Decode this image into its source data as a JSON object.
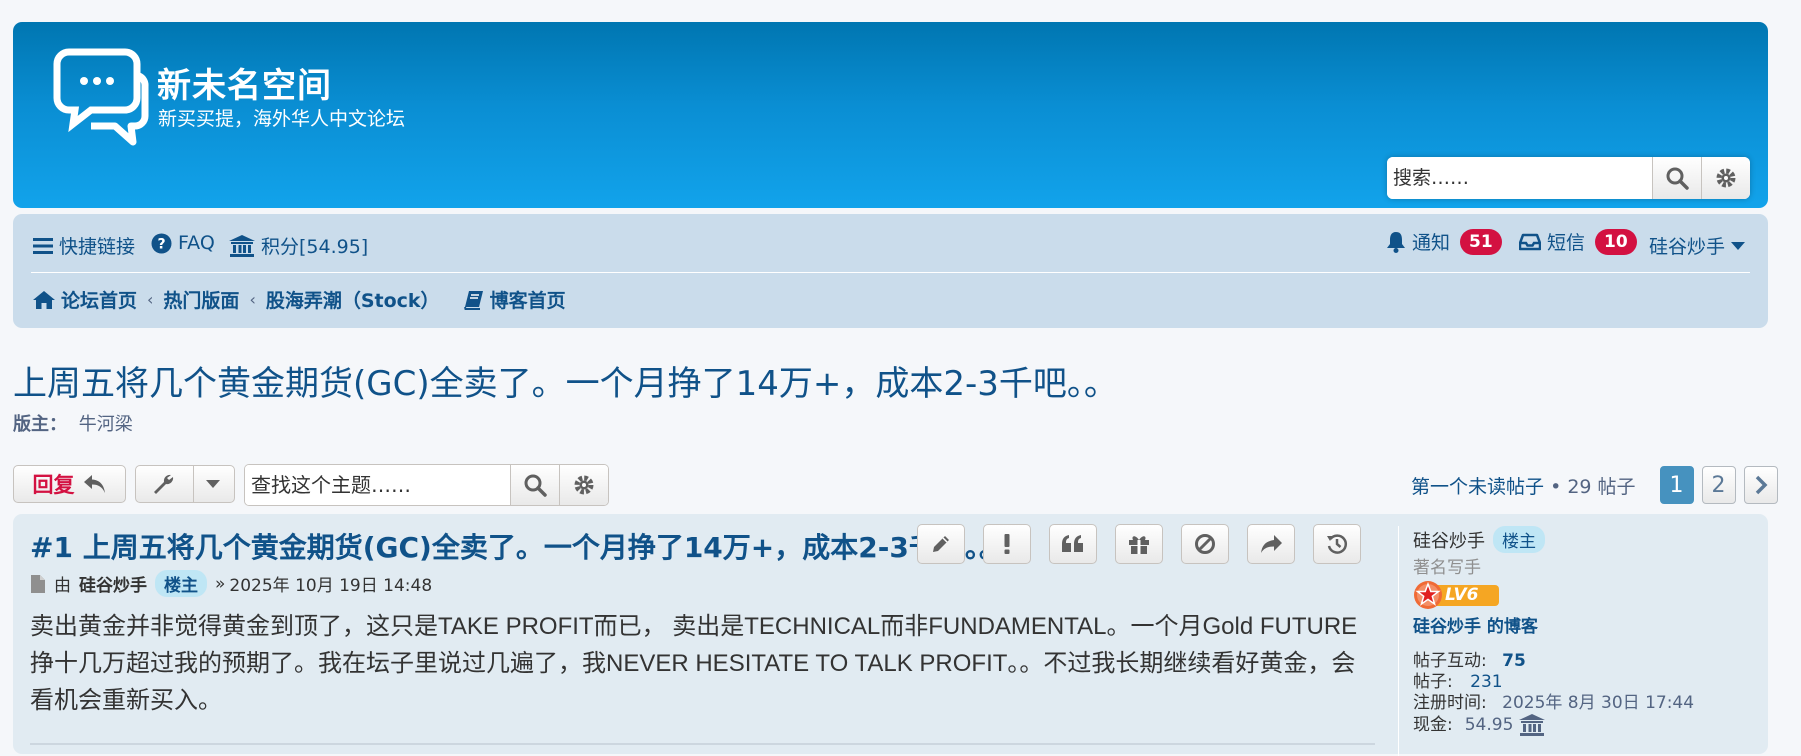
{
  "site": {
    "title": "新未名空间",
    "description": "新买买提，海外华人中文论坛",
    "search_placeholder": "搜索……"
  },
  "nav": {
    "quick_links": "快捷链接",
    "faq": "FAQ",
    "points": "积分[54.95]",
    "notifications_label": "通知",
    "notifications_count": "51",
    "messages_label": "短信",
    "messages_count": "10",
    "username": "硅谷炒手"
  },
  "breadcrumbs": {
    "home": "论坛首页",
    "hot": "热门版面",
    "forum": "股海弄潮（Stock）",
    "blog_home": "博客首页"
  },
  "topic": {
    "title": "上周五将几个黄金期货(GC)全卖了。一个月挣了14万+，成本2-3千吧。。",
    "moderator_label": "版主：",
    "moderator_name": "牛河梁"
  },
  "actions": {
    "reply_label": "回复",
    "find_placeholder": "查找这个主题……",
    "first_unread": "第一个未读帖子",
    "bullet": "•",
    "post_count": "29 帖子",
    "pages": [
      "1",
      "2"
    ]
  },
  "post": {
    "title": "#1 上周五将几个黄金期货(GC)全卖了。一个月挣了14万+，成本2-3千吧。。",
    "by_label": "由",
    "author": "硅谷炒手",
    "author_tag": "楼主",
    "date_prefix": "»",
    "date": "2025年 10月 19日 14:48",
    "body": "卖出黄金并非觉得黄金到顶了，这只是TAKE PROFIT而已， 卖出是TECHNICAL而非FUNDAMENTAL。一个月Gold FUTURE挣十几万超过我的预期了。我在坛子里说过几遍了，我NEVER HESITATE TO TALK PROFIT。。不过我长期继续看好黄金，会看机会重新买入。"
  },
  "profile": {
    "name": "硅谷炒手",
    "tag": "楼主",
    "rank": "著名写手",
    "level": "LV6",
    "blog_link": "硅谷炒手 的博客",
    "interactions_label": "帖子互动:",
    "interactions_value": "75",
    "posts_label": "帖子:",
    "posts_value": "231",
    "joined_label": "注册时间:",
    "joined_value": "2025年 8月 30日 17:44",
    "cash_label": "现金:",
    "cash_value": "54.95"
  },
  "colors": {
    "header_top": "#0076b1",
    "header_bottom": "#12a3eb",
    "navbar_bg": "#cadceb",
    "link": "#105289",
    "badge": "#d31141",
    "post_bg": "#e1ebf2",
    "page_current": "#4692bf"
  }
}
